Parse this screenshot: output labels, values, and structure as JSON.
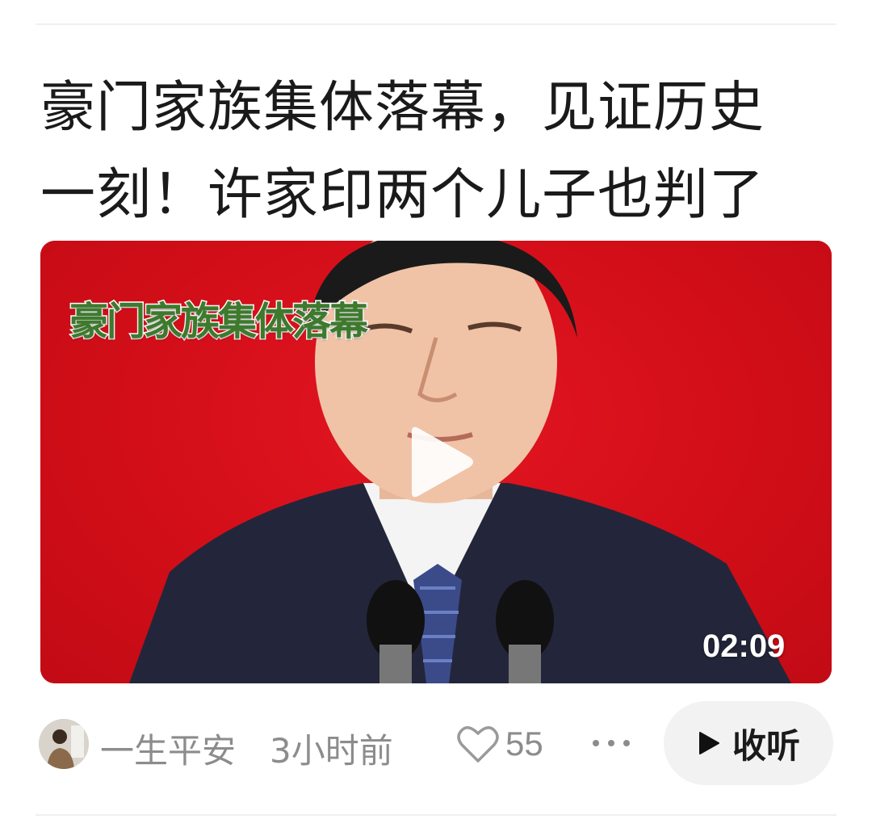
{
  "article": {
    "title": "豪门家族集体落幕，见证历史一刻！许家印两个儿子也判了"
  },
  "video": {
    "overlay_text": "豪门家族集体落幕",
    "duration": "02:09",
    "background_color": "#d9101a"
  },
  "meta": {
    "author": "一生平安",
    "time": "3小时前",
    "like_count": "55",
    "listen_label": "收听"
  },
  "icons": {
    "play": "play-icon",
    "heart": "heart-icon",
    "more": "more-dots-icon",
    "listen": "play-small-icon"
  }
}
